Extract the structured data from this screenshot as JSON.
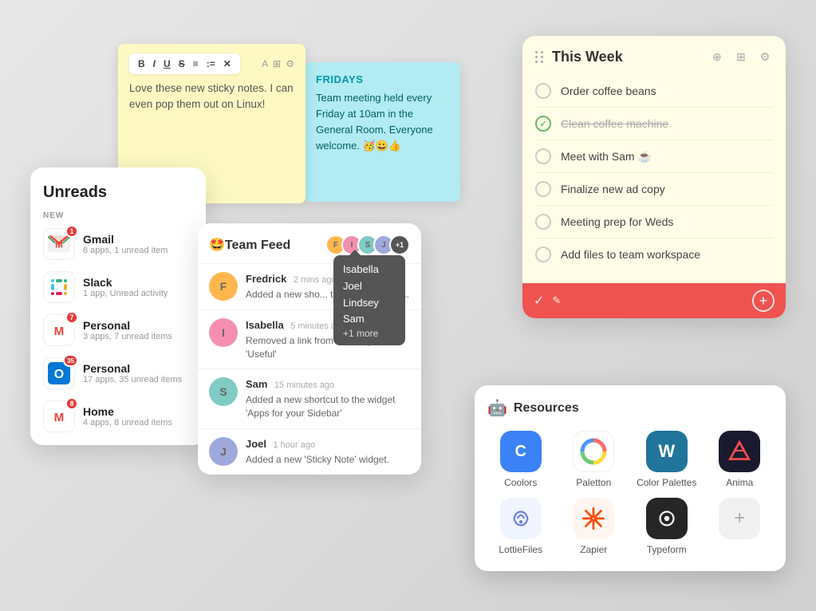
{
  "unreads": {
    "title": "Unreads",
    "section": "NEW",
    "items": [
      {
        "name": "Gmail",
        "desc": "8 apps, 1 unread item",
        "badge": "1",
        "color": "#EA4335",
        "iconType": "gmail"
      },
      {
        "name": "Slack",
        "desc": "1 app, Unread activity",
        "badge": null,
        "color": "#4A154B",
        "iconType": "slack"
      },
      {
        "name": "Personal",
        "desc": "3 apps, 7 unread items",
        "badge": "7",
        "color": "#EA4335",
        "iconType": "gmail"
      },
      {
        "name": "Personal",
        "desc": "17 apps, 35 unread items",
        "badge": "35",
        "color": "#0078D4",
        "iconType": "outlook"
      },
      {
        "name": "Home",
        "desc": "4 apps, 8 unread items",
        "badge": "8",
        "color": "#EA4335",
        "iconType": "gmail"
      }
    ]
  },
  "sticky_yellow": {
    "body": "Love these new sticky notes. I can even pop them out on Linux!"
  },
  "sticky_blue": {
    "title": "FRIDAYS",
    "body": "Team meeting held every Friday at 10am in the General Room.  Everyone welcome. 🥳😀👍"
  },
  "this_week": {
    "title": "This Week",
    "tasks": [
      {
        "label": "Order coffee beans",
        "done": false
      },
      {
        "label": "Clean coffee machine",
        "done": true
      },
      {
        "label": "Meet with Sam ☕",
        "done": false
      },
      {
        "label": "Finalize new ad copy",
        "done": false
      },
      {
        "label": "Meeting prep for Weds",
        "done": false
      },
      {
        "label": "Add files to team workspace",
        "done": false
      }
    ]
  },
  "team_feed": {
    "title": "🤩Team Feed",
    "avatars": [
      "F",
      "I",
      "S",
      "J"
    ],
    "avatar_count": "+1",
    "items": [
      {
        "name": "Fredrick",
        "time": "2 mins ago",
        "text": "Added a new shortcut to the widget 'Re..."
      },
      {
        "name": "Isabella",
        "time": "5 minutes ago",
        "text": "Removed a link from the widget 'Useful'"
      },
      {
        "name": "Sam",
        "time": "15 minutes ago",
        "text": "Added a new shortcut to the widget 'Apps for your Sidebar'"
      },
      {
        "name": "Joel",
        "time": "1 hour ago",
        "text": "Added a new 'Sticky Note' widget."
      }
    ]
  },
  "tooltip": {
    "names": [
      "Isabella",
      "Joel",
      "Lindsey",
      "Sam"
    ],
    "more": "+1 more"
  },
  "resources": {
    "title": "Resources",
    "emoji": "🤖",
    "items": [
      {
        "name": "Coolors",
        "iconType": "coolors"
      },
      {
        "name": "Paletton",
        "iconType": "paletton"
      },
      {
        "name": "Color Palettes",
        "iconType": "wordpress"
      },
      {
        "name": "Anima",
        "iconType": "anima"
      },
      {
        "name": "LottieFiles",
        "iconType": "lottie"
      },
      {
        "name": "Zapier",
        "iconType": "zapier"
      },
      {
        "name": "Typeform",
        "iconType": "typeform"
      },
      {
        "name": "",
        "iconType": "add"
      }
    ]
  }
}
